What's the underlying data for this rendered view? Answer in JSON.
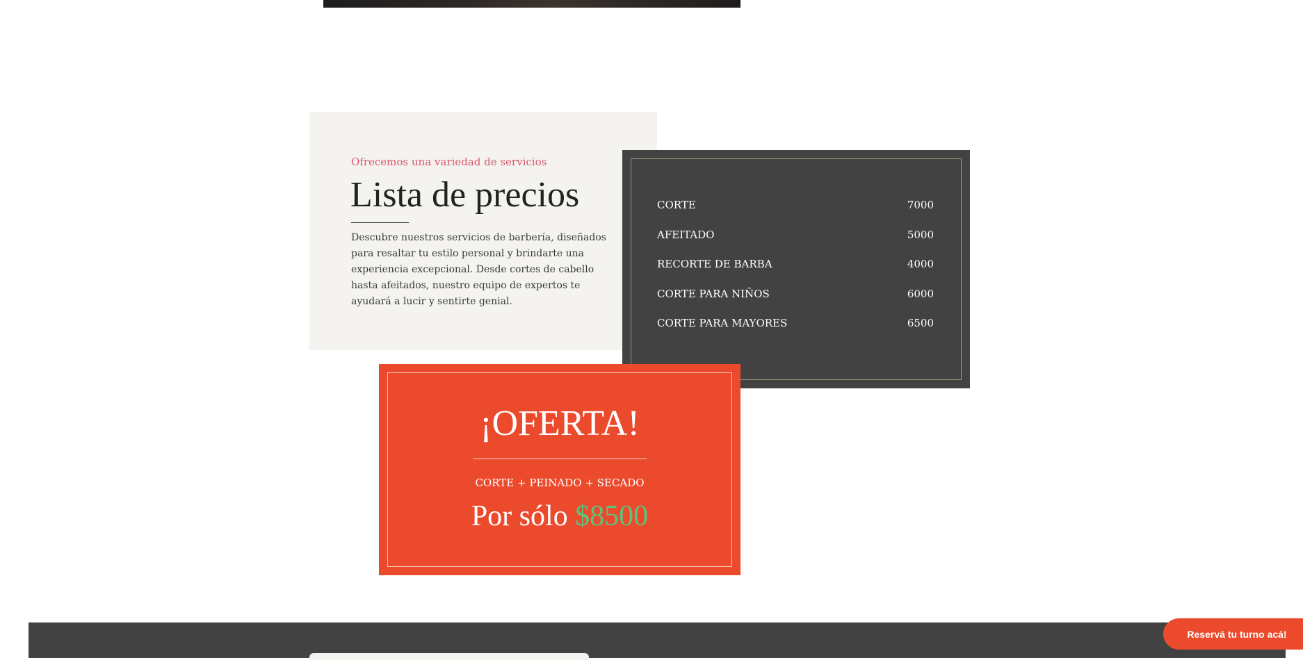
{
  "intro": {
    "eyebrow": "Ofrecemos una variedad de servicios",
    "title": "Lista de precios",
    "description": "Descubre nuestros servicios de barbería, diseñados para resaltar tu estilo personal y brindarte una experiencia excepcional. Desde cortes de cabello hasta afeitados, nuestro equipo de expertos te ayudará a lucir y sentirte genial."
  },
  "prices": {
    "items": [
      {
        "name": "CORTE",
        "price": "7000"
      },
      {
        "name": "AFEITADO",
        "price": "5000"
      },
      {
        "name": "RECORTE DE BARBA",
        "price": "4000"
      },
      {
        "name": "CORTE PARA NIÑOS",
        "price": "6000"
      },
      {
        "name": "CORTE PARA MAYORES",
        "price": "6500"
      }
    ]
  },
  "offer": {
    "title": "¡OFERTA!",
    "subtitle": "CORTE + PEINADO + SECADO",
    "price_prefix": "Por sólo",
    "price_amount": "$8500"
  },
  "booking": {
    "label": "Reservá tu turno acá!"
  },
  "colors": {
    "accent_red": "#ec4a2c",
    "accent_pink": "#d9556e",
    "accent_green": "#5cc37d",
    "dark_panel": "#424242",
    "light_panel": "#f4f3ef"
  }
}
